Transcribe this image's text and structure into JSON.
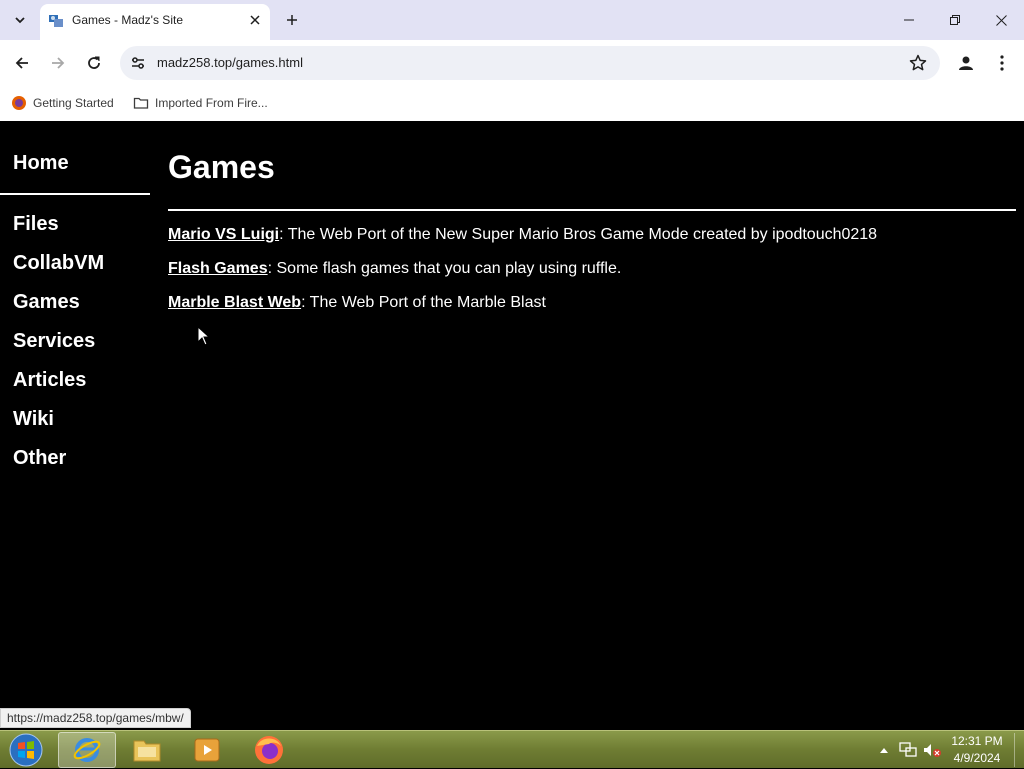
{
  "browser": {
    "tab_title": "Games - Madz's Site",
    "url": "madz258.top/games.html",
    "bookmarks": [
      {
        "label": "Getting Started"
      },
      {
        "label": "Imported From Fire..."
      }
    ],
    "status_url": "https://madz258.top/games/mbw/"
  },
  "sidebar": {
    "home": "Home",
    "items": [
      {
        "label": "Files"
      },
      {
        "label": "CollabVM"
      },
      {
        "label": "Games"
      },
      {
        "label": "Services"
      },
      {
        "label": "Articles"
      },
      {
        "label": "Wiki"
      },
      {
        "label": "Other"
      }
    ]
  },
  "main": {
    "title": "Games",
    "games": [
      {
        "link": "Mario VS Luigi",
        "desc": ": The Web Port of the New Super Mario Bros Game Mode created by ipodtouch0218"
      },
      {
        "link": "Flash Games",
        "desc": ": Some flash games that you can play using ruffle."
      },
      {
        "link": "Marble Blast Web",
        "desc": ": The Web Port of the Marble Blast"
      }
    ]
  },
  "taskbar": {
    "time": "12:31 PM",
    "date": "4/9/2024"
  },
  "colors": {
    "tabstrip": "#e2e2f4",
    "page_bg": "#000000",
    "taskbar": "#6f7d33"
  }
}
